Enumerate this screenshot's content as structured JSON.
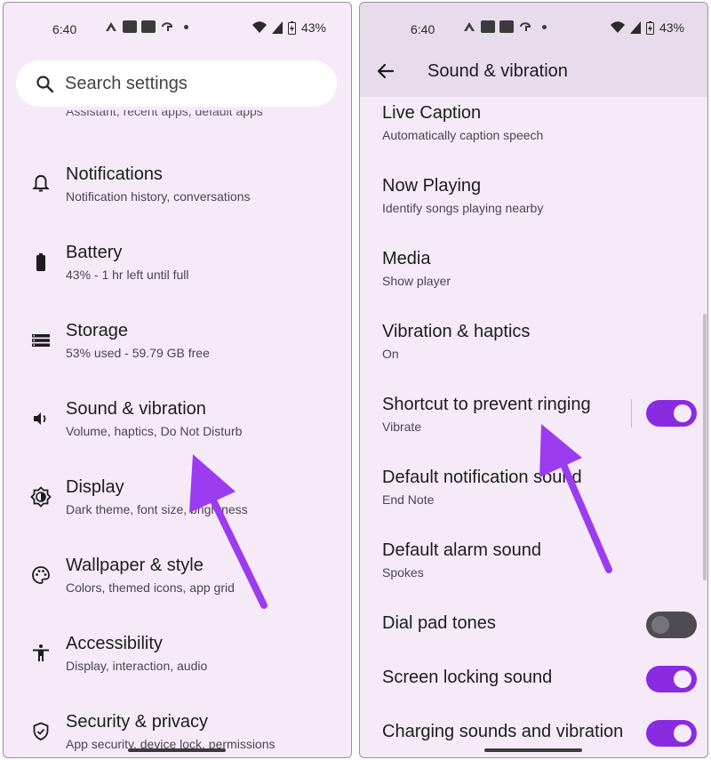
{
  "left": {
    "status": {
      "time": "6:40",
      "battery": "43%"
    },
    "search": {
      "placeholder": "Search settings"
    },
    "clipped_subtitle": "Assistant, recent apps, default apps",
    "items": [
      {
        "title": "Notifications",
        "subtitle": "Notification history, conversations",
        "icon": "bell-icon"
      },
      {
        "title": "Battery",
        "subtitle": "43% - 1 hr left until full",
        "icon": "battery-icon"
      },
      {
        "title": "Storage",
        "subtitle": "53% used - 59.79 GB free",
        "icon": "storage-icon"
      },
      {
        "title": "Sound & vibration",
        "subtitle": "Volume, haptics, Do Not Disturb",
        "icon": "volume-icon"
      },
      {
        "title": "Display",
        "subtitle": "Dark theme, font size, brightness",
        "icon": "brightness-icon"
      },
      {
        "title": "Wallpaper & style",
        "subtitle": "Colors, themed icons, app grid",
        "icon": "palette-icon"
      },
      {
        "title": "Accessibility",
        "subtitle": "Display, interaction, audio",
        "icon": "accessibility-icon"
      },
      {
        "title": "Security & privacy",
        "subtitle": "App security, device lock, permissions",
        "icon": "shield-icon"
      }
    ]
  },
  "right": {
    "status": {
      "time": "6:40",
      "battery": "43%"
    },
    "app_bar": {
      "title": "Sound & vibration"
    },
    "prefs": [
      {
        "title": "Live Caption",
        "subtitle": "Automatically caption speech"
      },
      {
        "title": "Now Playing",
        "subtitle": "Identify songs playing nearby"
      },
      {
        "title": "Media",
        "subtitle": "Show player"
      },
      {
        "title": "Vibration & haptics",
        "subtitle": "On"
      },
      {
        "title": "Shortcut to prevent ringing",
        "subtitle": "Vibrate",
        "toggle": "on"
      },
      {
        "title": "Default notification sound",
        "subtitle": "End Note"
      },
      {
        "title": "Default alarm sound",
        "subtitle": "Spokes"
      },
      {
        "title": "Dial pad tones",
        "toggle": "off"
      },
      {
        "title": "Screen locking sound",
        "toggle": "on"
      },
      {
        "title": "Charging sounds and vibration",
        "toggle": "on"
      }
    ]
  },
  "colors": {
    "background": "#f7eaf8",
    "app_bar": "#e8dbeb",
    "accent": "#8a2be2",
    "arrow": "#9b3cf0"
  }
}
